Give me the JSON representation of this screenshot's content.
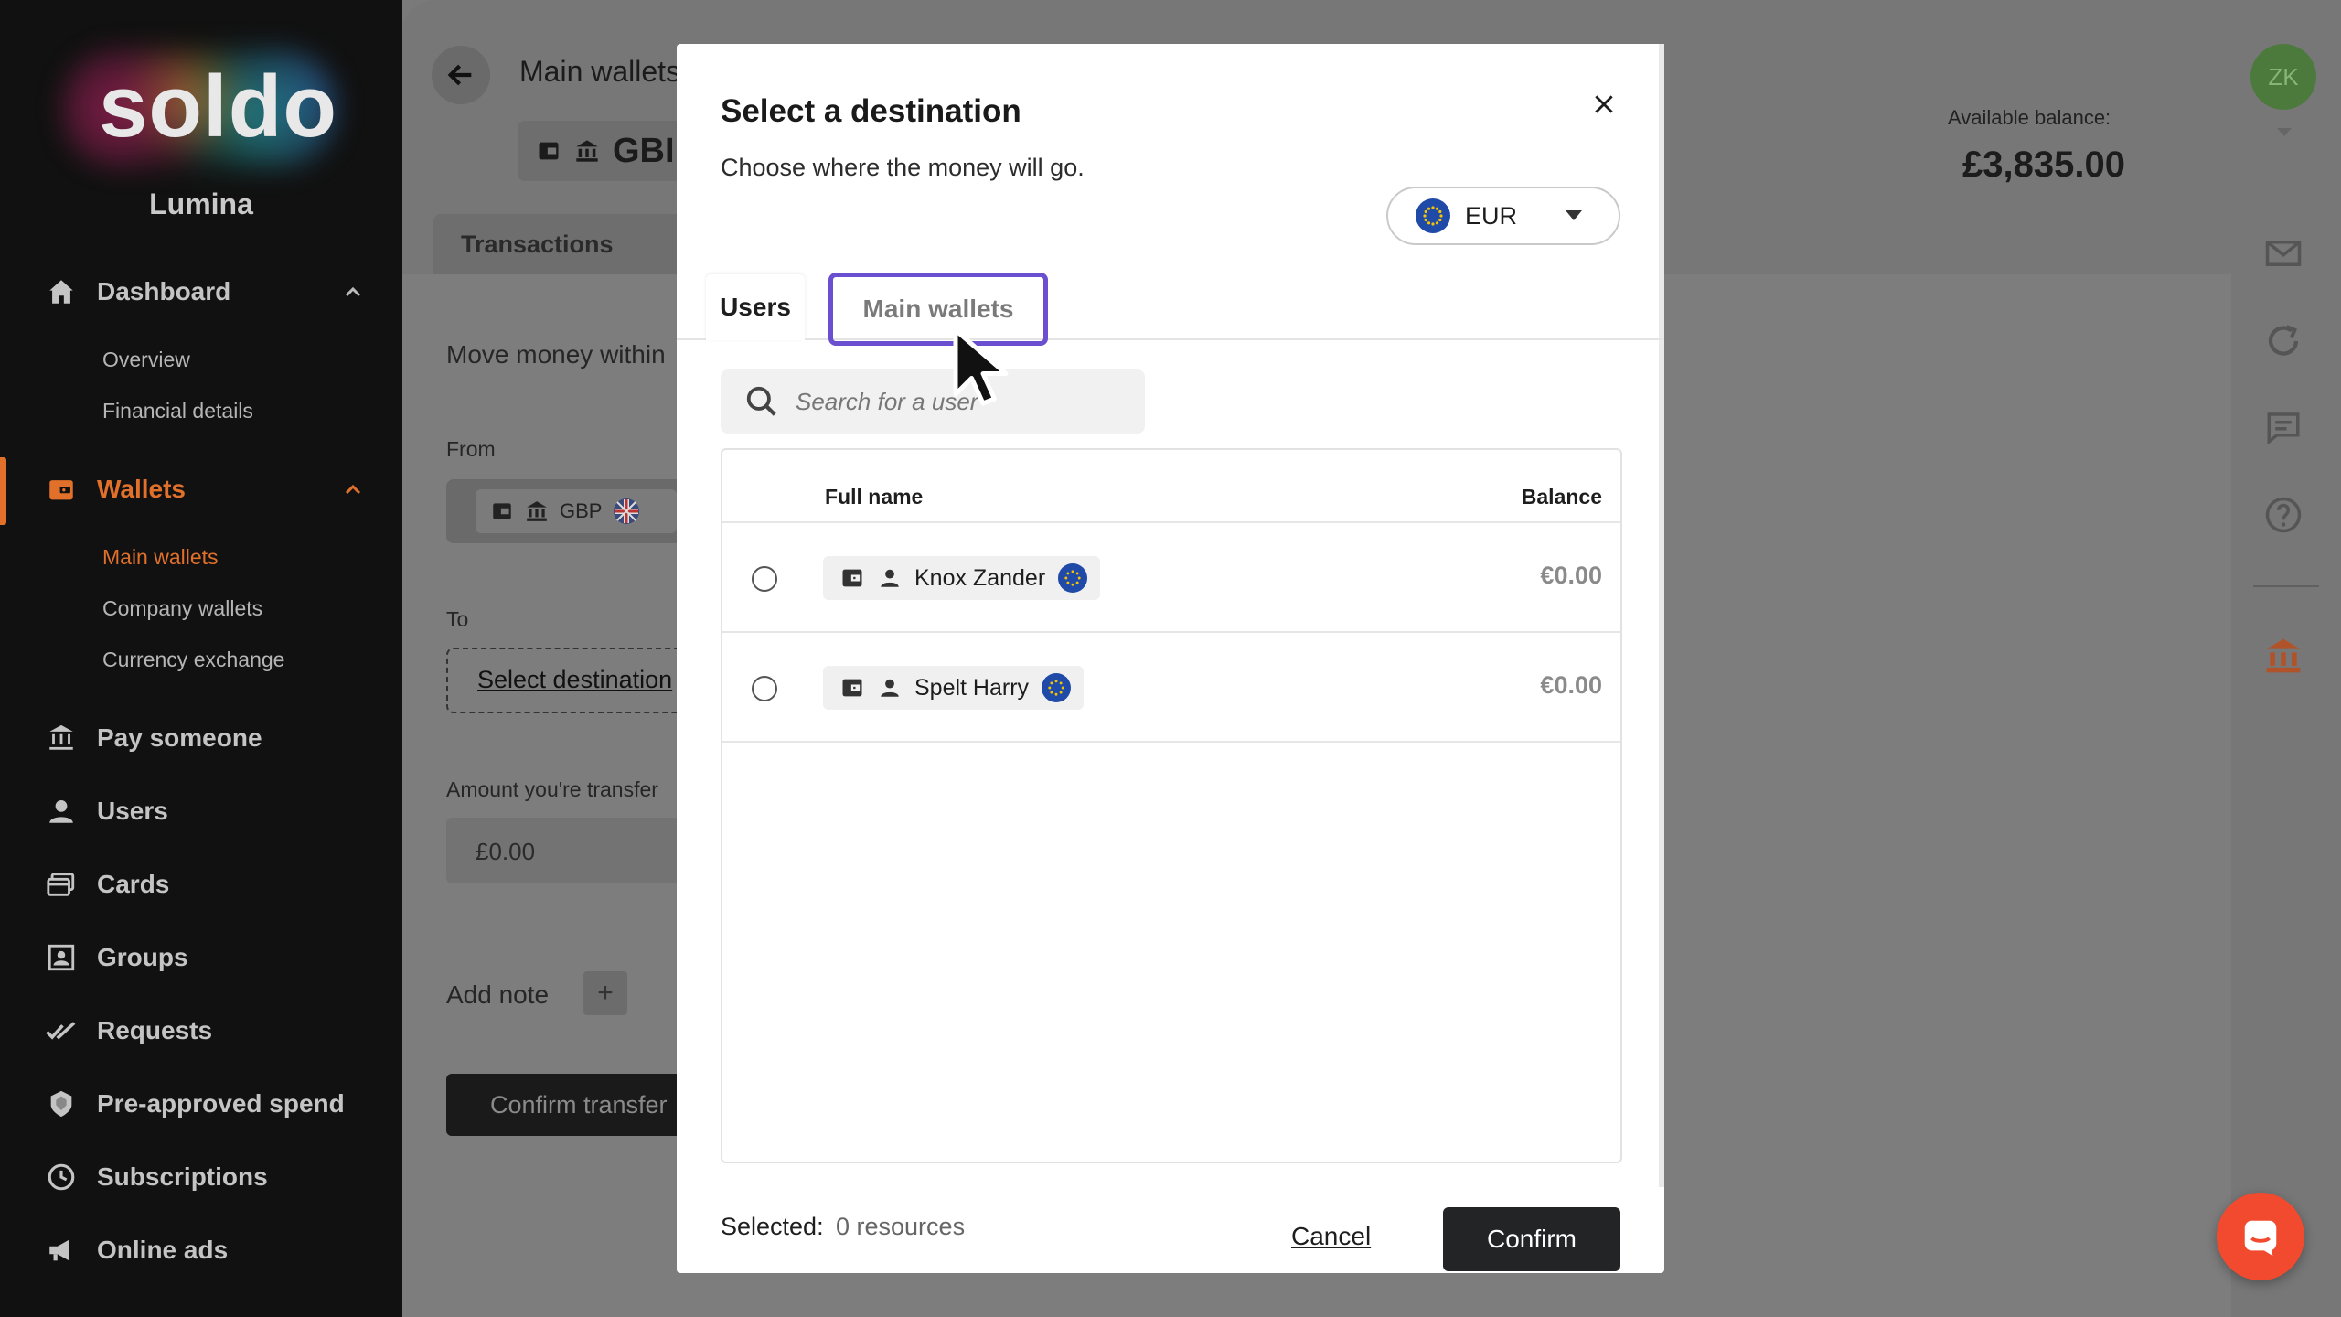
{
  "brand": {
    "logo_text": "soldo",
    "company": "Lumina"
  },
  "sidebar": {
    "items": [
      {
        "label": "Dashboard",
        "icon": "home-icon",
        "expanded": true,
        "children": [
          {
            "label": "Overview"
          },
          {
            "label": "Financial details"
          }
        ]
      },
      {
        "label": "Wallets",
        "icon": "wallet-icon",
        "expanded": true,
        "active": true,
        "children": [
          {
            "label": "Main wallets",
            "active": true
          },
          {
            "label": "Company wallets"
          },
          {
            "label": "Currency exchange"
          }
        ]
      },
      {
        "label": "Pay someone",
        "icon": "bank-transfer-icon"
      },
      {
        "label": "Users",
        "icon": "user-icon"
      },
      {
        "label": "Cards",
        "icon": "cards-icon"
      },
      {
        "label": "Groups",
        "icon": "groups-icon"
      },
      {
        "label": "Requests",
        "icon": "check-icon"
      },
      {
        "label": "Pre-approved spend",
        "icon": "shield-icon"
      },
      {
        "label": "Subscriptions",
        "icon": "clock-icon"
      },
      {
        "label": "Online ads",
        "icon": "megaphone-icon"
      }
    ]
  },
  "page": {
    "title": "Main wallets",
    "currency_chip": "GBI",
    "tab": "Transactions",
    "available_balance_label": "Available balance:",
    "available_balance": "£3,835.00",
    "move_money_text": "Move money within",
    "from_label": "From",
    "from_currency": "GBP",
    "to_label": "To",
    "select_destination": "Select destination",
    "amount_label": "Amount you're transfer",
    "amount_value": "£0.00",
    "add_note": "Add note",
    "confirm_transfer": "Confirm transfer"
  },
  "user_avatar": "ZK",
  "modal": {
    "title": "Select a destination",
    "subtitle": "Choose where the money will go.",
    "currency": "EUR",
    "tabs": [
      {
        "label": "Users",
        "active": true
      },
      {
        "label": "Main wallets",
        "highlighted": true
      }
    ],
    "search_placeholder": "Search for a user",
    "table": {
      "headers": {
        "name": "Full name",
        "balance": "Balance"
      },
      "rows": [
        {
          "name": "Knox Zander",
          "balance": "€0.00"
        },
        {
          "name": "Spelt Harry",
          "balance": "€0.00"
        }
      ]
    },
    "selected_label": "Selected:",
    "selected_count": "0 resources",
    "cancel": "Cancel",
    "confirm": "Confirm"
  },
  "colors": {
    "accent": "#e0702a",
    "highlight": "#6a4fd1",
    "chat": "#f24a2e",
    "eu_blue": "#1f4aa8"
  }
}
